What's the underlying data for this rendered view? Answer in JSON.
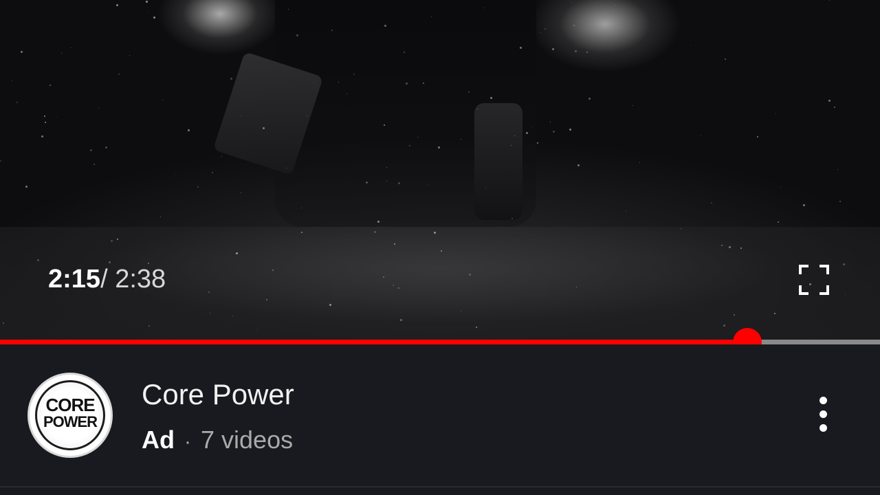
{
  "player": {
    "time_current": "2:15",
    "time_separator": "/",
    "time_duration": "2:38",
    "progress_fraction": 0.849,
    "accent_color": "#ff0000",
    "fullscreen_icon": "fullscreen-icon"
  },
  "channel": {
    "name": "Core Power",
    "badge": "Ad",
    "separator": "·",
    "video_count": "7 videos",
    "avatar_line1": "CORE",
    "avatar_line2": "POWER",
    "more_icon": "more-vert-icon"
  }
}
